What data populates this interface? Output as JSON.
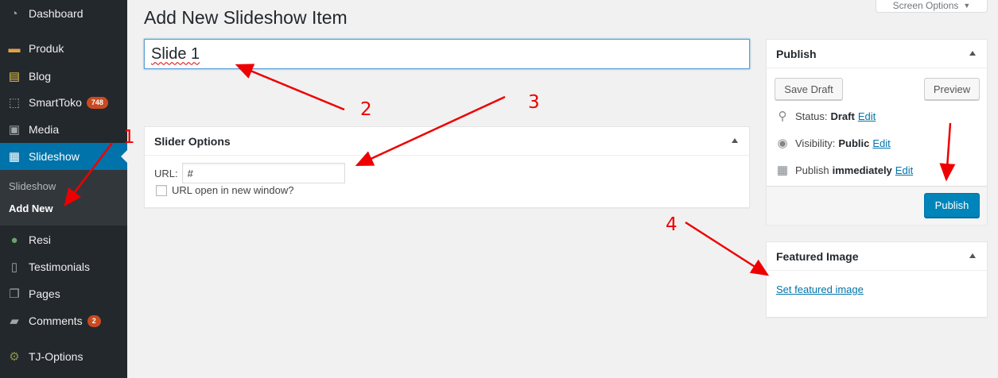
{
  "sidebar": {
    "items": [
      {
        "label": "Dashboard",
        "icon": "dashboard-icon",
        "glyph": "◔"
      },
      {
        "label": "Produk",
        "icon": "products-icon",
        "glyph": "▬"
      },
      {
        "label": "Blog",
        "icon": "blog-icon",
        "glyph": "▤"
      },
      {
        "label": "SmartToko",
        "icon": "store-icon",
        "glyph": "⬚",
        "badge": "748"
      },
      {
        "label": "Media",
        "icon": "media-icon",
        "glyph": "▣"
      },
      {
        "label": "Slideshow",
        "icon": "slideshow-icon",
        "glyph": "▦"
      },
      {
        "label": "Resi",
        "icon": "location-icon",
        "glyph": "●"
      },
      {
        "label": "Testimonials",
        "icon": "testimonials-icon",
        "glyph": "▯"
      },
      {
        "label": "Pages",
        "icon": "pages-icon",
        "glyph": "❐"
      },
      {
        "label": "Comments",
        "icon": "comments-icon",
        "glyph": "▰",
        "badge": "2"
      },
      {
        "label": "TJ-Options",
        "icon": "options-icon",
        "glyph": "⚙"
      }
    ],
    "submenu": {
      "parent": "Slideshow",
      "active": "Add New"
    }
  },
  "header": {
    "title": "Add New Slideshow Item",
    "screen_options": "Screen Options"
  },
  "editor": {
    "title_value": "Slide 1"
  },
  "slider_options": {
    "heading": "Slider Options",
    "url_label": "URL:",
    "url_value": "#",
    "new_window_label": "URL open in new window?"
  },
  "publish": {
    "heading": "Publish",
    "save_draft": "Save Draft",
    "preview": "Preview",
    "status_label": "Status:",
    "status_value": "Draft",
    "visibility_label": "Visibility:",
    "visibility_value": "Public",
    "publish_label": "Publish",
    "publish_value": "immediately",
    "edit": "Edit",
    "publish_button": "Publish"
  },
  "featured_image": {
    "heading": "Featured Image",
    "link": "Set featured image"
  },
  "annotations": [
    "1",
    "2",
    "3",
    "4"
  ],
  "colors": {
    "accent": "#0073aa",
    "sidebar": "#23282d",
    "annotation": "#e00000",
    "badge": "#ca4a1f"
  }
}
